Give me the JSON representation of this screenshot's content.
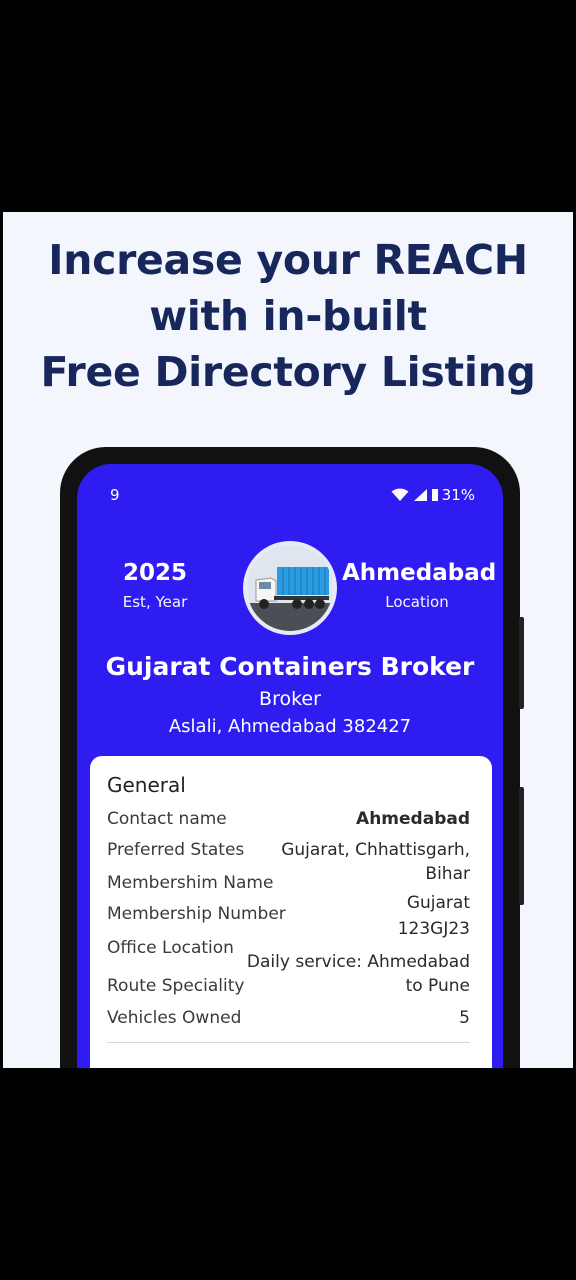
{
  "headline": {
    "line1": "Increase your REACH",
    "line2": "with in-built",
    "line3": "Free Directory Listing"
  },
  "status_bar": {
    "time": "9",
    "battery": "31%"
  },
  "profile": {
    "established_year": "2025",
    "established_label": "Est, Year",
    "location": "Ahmedabad",
    "location_label": "Location",
    "name": "Gujarat Containers Broker",
    "role": "Broker",
    "address": "Aslali, Ahmedabad 382427"
  },
  "general": {
    "heading": "General",
    "rows": [
      {
        "label": "Contact name",
        "value": "Ahmedabad"
      },
      {
        "label": "Preferred States",
        "value": "Gujarat, Chhattisgarh,"
      },
      {
        "label": "Membershim Name",
        "value": "Bihar"
      },
      {
        "label": "Membership Number",
        "value": "Gujarat"
      },
      {
        "label": "Office Location",
        "value": "123GJ23"
      },
      {
        "label": "Route Speciality",
        "value": "Daily service: Ahmedabad"
      },
      {
        "label": "Vehicles Owned",
        "value": "to Pune"
      }
    ],
    "vehicles_count": "5"
  },
  "colors": {
    "brand_blue": "#2f1cf0",
    "headline_navy": "#17275b",
    "banner_bg": "#f3f6fc"
  }
}
